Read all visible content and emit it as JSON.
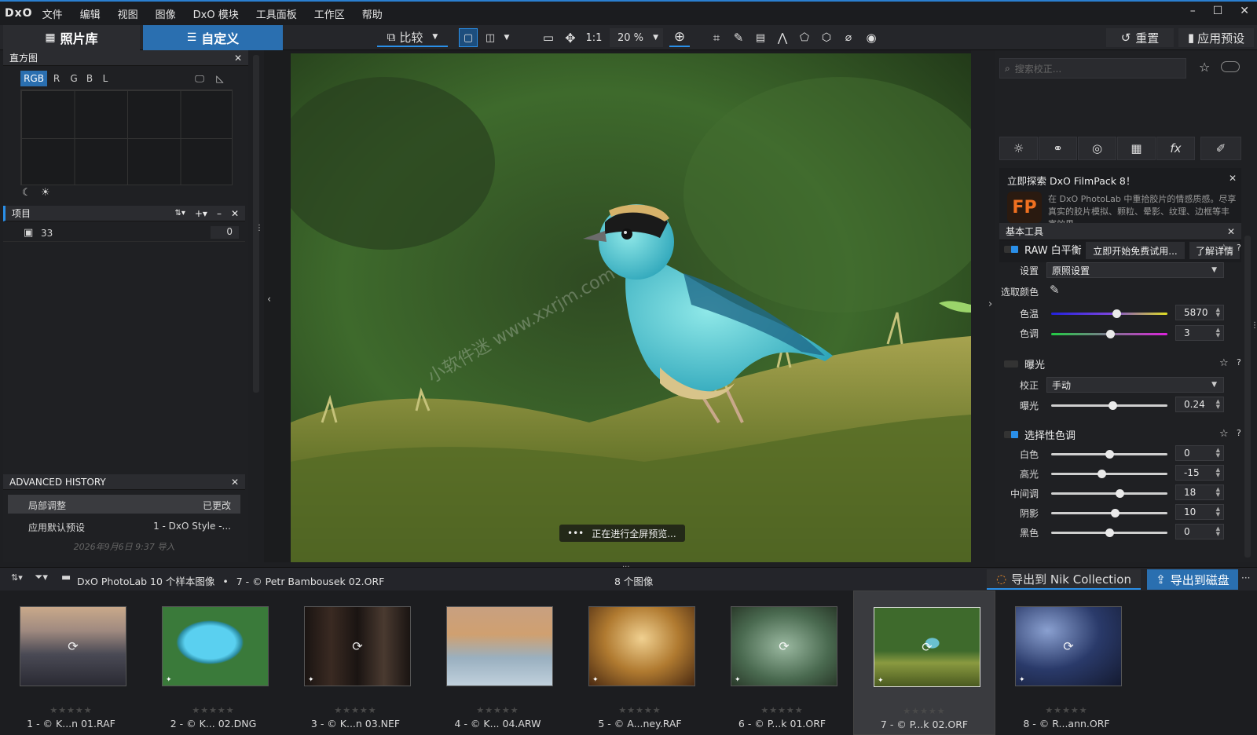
{
  "menu": {
    "logo": "DxO",
    "items": [
      "文件",
      "编辑",
      "视图",
      "图像",
      "DxO 模块",
      "工具面板",
      "工作区",
      "帮助"
    ],
    "window_controls": [
      "–",
      "☐",
      "✕"
    ]
  },
  "toolbar": {
    "tab_library": "照片库",
    "tab_customize": "自定义",
    "compare": "比较",
    "one_to_one": "1:1",
    "zoom": "20 %",
    "reset": "重置",
    "apply_preset": "应用预设"
  },
  "histogram": {
    "title": "直方图",
    "channels": [
      "RGB",
      "R",
      "G",
      "B",
      "L"
    ]
  },
  "project": {
    "title": "项目",
    "item_name": "33",
    "item_count": "0"
  },
  "history": {
    "title": "ADVANCED HISTORY",
    "rows": [
      {
        "action": "局部调整",
        "state": "已更改"
      },
      {
        "action": "应用默认预设",
        "state": "1 - DxO Style -..."
      }
    ],
    "footer": "2026年9月6日 9:37 导入"
  },
  "viewer": {
    "status": "正在进行全屏预览...",
    "dots": "•••",
    "watermark": "小软件迷 www.xxrjm.com"
  },
  "right": {
    "search_placeholder": "搜索校正...",
    "promo": {
      "title": "立即探索 DxO FilmPack 8！",
      "logo": "FP",
      "body": "在 DxO PhotoLab 中重拾胶片的情感质感。尽享真实的胶片模拟、颗粒、晕影、纹理、边框等丰富效果。",
      "trial_button": "立即开始免费试用...",
      "learn_button": "了解详情"
    },
    "basic_tools": "基本工具",
    "wb": {
      "title": "RAW 白平衡",
      "setting_label": "设置",
      "setting_value": "原照设置",
      "picker_label": "选取颜色",
      "temp_label": "色温",
      "temp_value": "5870",
      "temp_level": 0.56,
      "tint_label": "色调",
      "tint_value": "3",
      "tint_level": 0.51
    },
    "exposure": {
      "title": "曝光",
      "mode_label": "校正",
      "mode_value": "手动",
      "exp_label": "曝光",
      "exp_value": "0.24",
      "exp_level": 0.53
    },
    "tone": {
      "title": "选择性色调",
      "sliders": [
        {
          "label": "白色",
          "value": "0",
          "level": 0.5
        },
        {
          "label": "高光",
          "value": "-15",
          "level": 0.43
        },
        {
          "label": "中间调",
          "value": "18",
          "level": 0.59
        },
        {
          "label": "阴影",
          "value": "10",
          "level": 0.55
        },
        {
          "label": "黑色",
          "value": "0",
          "level": 0.5
        }
      ]
    }
  },
  "bottom": {
    "path_root": "DxO PhotoLab 10 个样本图像",
    "path_sep": "•",
    "path_file": "7 - © Petr Bambousek 02.ORF",
    "count": "8 个图像",
    "export_nik": "导出到 Nik Collection",
    "export_disk": "导出到磁盘",
    "more": "···"
  },
  "thumbnails": [
    {
      "caption": "1 - © K...n 01.RAF",
      "stars": "★★★★★"
    },
    {
      "caption": "2 - © K... 02.DNG",
      "stars": "★★★★★"
    },
    {
      "caption": "3 - © K...n 03.NEF",
      "stars": "★★★★★"
    },
    {
      "caption": "4 - © K... 04.ARW",
      "stars": "★★★★★"
    },
    {
      "caption": "5 - © A...ney.RAF",
      "stars": "★★★★★"
    },
    {
      "caption": "6 - © P...k 01.ORF",
      "stars": "★★★★★"
    },
    {
      "caption": "7 - © P...k 02.ORF",
      "stars": "★★★★★"
    },
    {
      "caption": "8 - © R...ann.ORF",
      "stars": "★★★★★"
    }
  ],
  "colors": {
    "accent": "#2a8fe8",
    "tab_active": "#2a6fb0",
    "panel": "#1f2023"
  }
}
